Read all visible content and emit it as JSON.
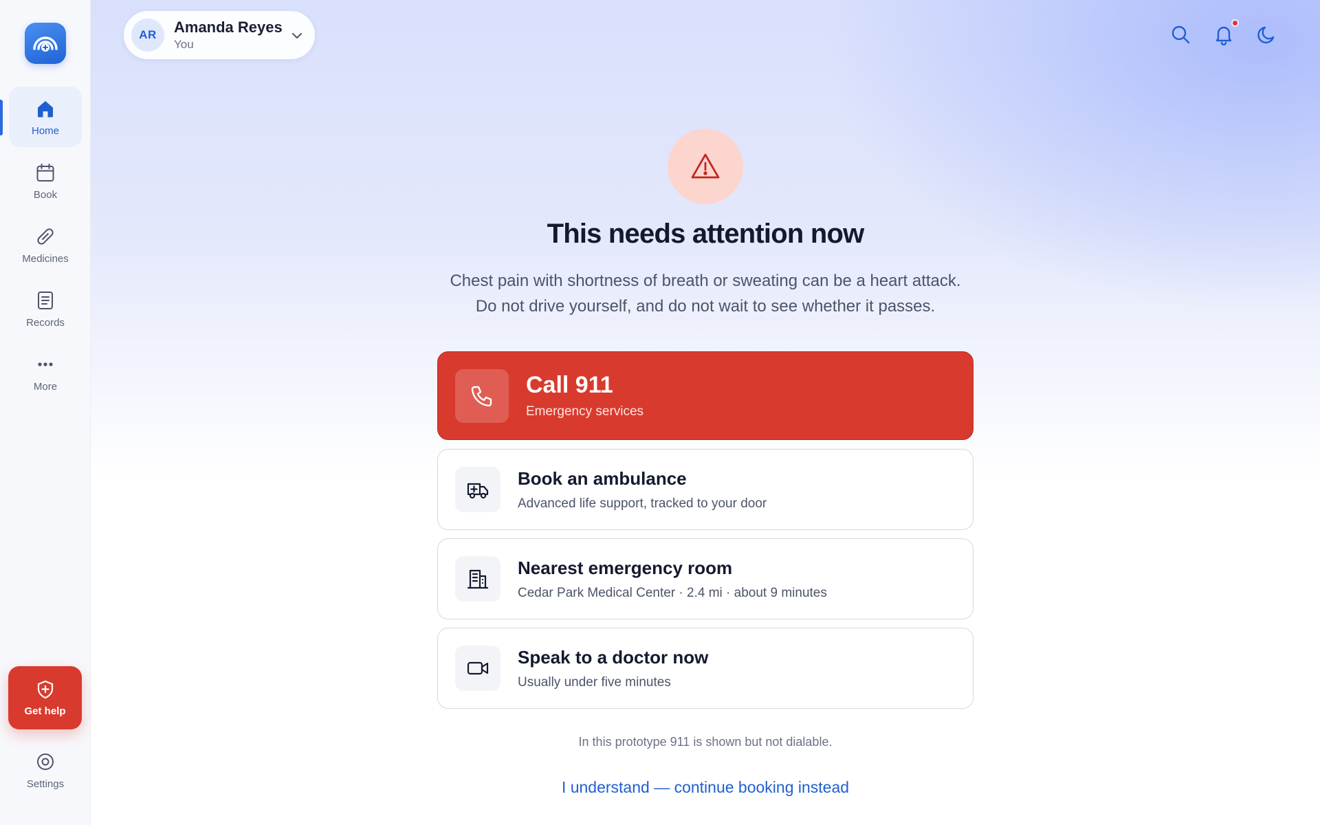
{
  "sidebar": {
    "items": [
      {
        "label": "Home",
        "icon": "home-icon",
        "active": true
      },
      {
        "label": "Book",
        "icon": "calendar-icon",
        "active": false
      },
      {
        "label": "Medicines",
        "icon": "pill-icon",
        "active": false
      },
      {
        "label": "Records",
        "icon": "document-icon",
        "active": false
      },
      {
        "label": "More",
        "icon": "more-icon",
        "active": false
      }
    ],
    "get_help": "Get help",
    "settings": "Settings"
  },
  "header": {
    "avatar_initials": "AR",
    "profile_name": "Amanda Reyes",
    "profile_sub": "You",
    "has_notification": true
  },
  "alert": {
    "title": "This needs attention now",
    "line1": "Chest pain with shortness of breath or sweating can be a heart attack.",
    "line2": "Do not drive yourself, and do not wait to see whether it passes."
  },
  "actions": [
    {
      "title": "Call 911",
      "subtitle": "Emergency services",
      "icon": "phone-icon"
    },
    {
      "title": "Book an ambulance",
      "subtitle": "Advanced life support, tracked to your door",
      "icon": "ambulance-icon"
    },
    {
      "title": "Nearest emergency room",
      "subtitle": "Cedar Park Medical Center · 2.4 mi · about 9 minutes",
      "icon": "hospital-icon"
    },
    {
      "title": "Speak to a doctor now",
      "subtitle": "Usually under five minutes",
      "icon": "video-icon"
    }
  ],
  "footnote": "In this prototype 911 is shown but not dialable.",
  "continue_link": "I understand — continue booking instead",
  "colors": {
    "accent": "#1f5fd0",
    "emergency": "#d93a2e",
    "alert_bg": "#fdd5cf"
  }
}
